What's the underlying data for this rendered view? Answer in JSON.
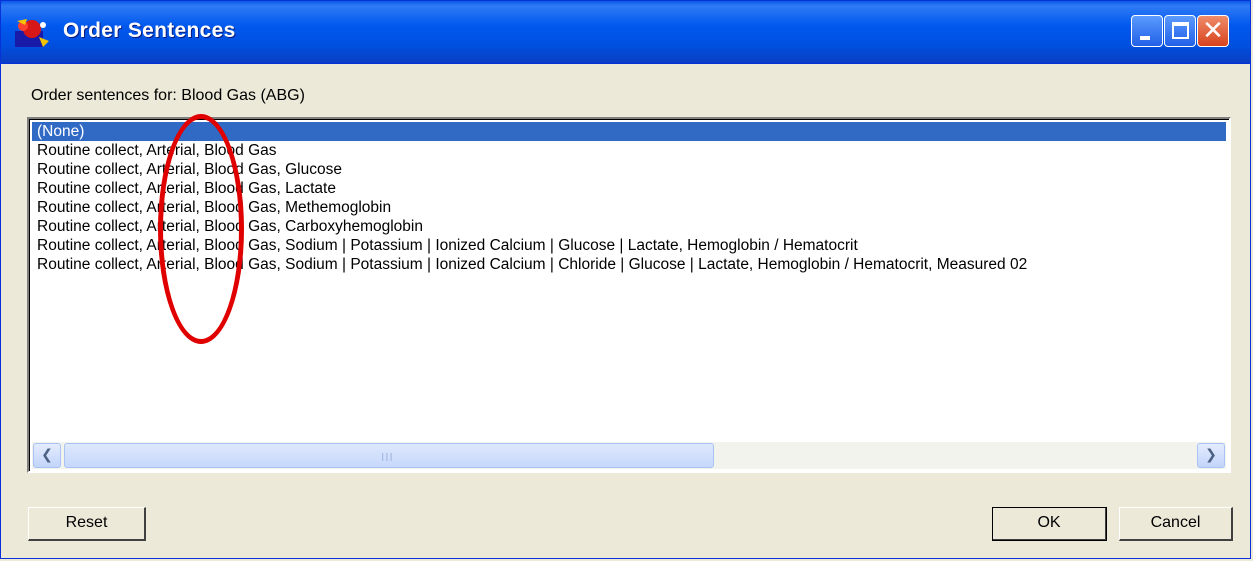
{
  "window": {
    "title": "Order Sentences",
    "icon": "app-logo-icon"
  },
  "header": {
    "label": "Order sentences for:  Blood Gas (ABG)"
  },
  "list": {
    "items": [
      "(None)",
      "Routine collect, Arterial, Blood Gas",
      "Routine collect, Arterial, Blood Gas, Glucose",
      "Routine collect, Arterial, Blood Gas, Lactate",
      "Routine collect, Arterial, Blood Gas, Methemoglobin",
      "Routine collect, Arterial, Blood Gas, Carboxyhemoglobin",
      "Routine collect, Arterial, Blood Gas, Sodium | Potassium | Ionized Calcium | Glucose | Lactate, Hemoglobin / Hematocrit",
      "Routine collect, Arterial, Blood Gas, Sodium | Potassium | Ionized Calcium | Chloride | Glucose | Lactate, Hemoglobin / Hematocrit, Measured 02"
    ],
    "selected_index": 0
  },
  "scrollbar": {
    "grip": "III"
  },
  "buttons": {
    "reset": "Reset",
    "ok": "OK",
    "cancel": "Cancel"
  },
  "colors": {
    "selection": "#316ac5",
    "annotation": "#e00000",
    "titlebar": "#0058ee"
  }
}
